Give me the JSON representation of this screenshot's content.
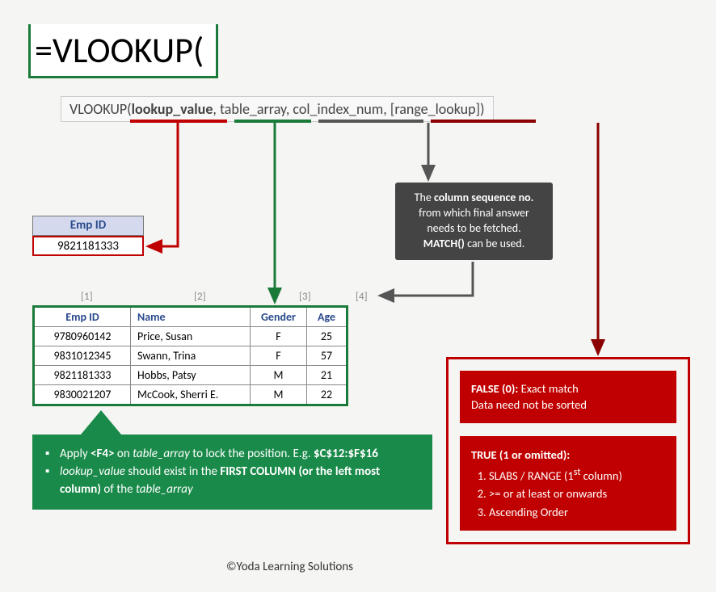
{
  "formula": "=VLOOKUP(",
  "syntax": {
    "fn": "VLOOKUP(",
    "arg1": "lookup_value",
    "sep": ", ",
    "arg2": "table_array",
    "arg3": "col_index_num",
    "arg4": "[range_lookup]",
    "close": ")"
  },
  "lookup_cell": {
    "header": "Emp ID",
    "value": "9821181333"
  },
  "col_nums": [
    "[1]",
    "[2]",
    "[3]",
    "[4]"
  ],
  "table": {
    "headers": [
      "Emp ID",
      "Name",
      "Gender",
      "Age"
    ],
    "rows": [
      [
        "9780960142",
        "Price, Susan",
        "F",
        "25"
      ],
      [
        "9831012345",
        "Swann, Trina",
        "F",
        "57"
      ],
      [
        "9821181333",
        "Hobbs, Patsy",
        "M",
        "21"
      ],
      [
        "9830021207",
        "McCook, Sherri E.",
        "M",
        "22"
      ]
    ]
  },
  "dark_callout": {
    "l1a": "The ",
    "l1b": "column sequence no.",
    "l2": "from which final answer",
    "l3": "needs to be fetched.",
    "l4a": "MATCH()",
    "l4b": " can be used."
  },
  "green_callout": {
    "tip1_a": "Apply ",
    "tip1_b": "<F4>",
    "tip1_c": " on ",
    "tip1_d": "table_array",
    "tip1_e": " to lock the position. E.g. ",
    "tip1_f": "$C$12:$F$16",
    "tip2_a": "lookup_value",
    "tip2_b": " should exist in the ",
    "tip2_c": "FIRST COLUMN (or the left most column)",
    "tip2_d": " of the ",
    "tip2_e": "table_array"
  },
  "red_box": {
    "false_title": "FALSE (0):",
    "false_text": " Exact match",
    "false_l2": "Data need not be sorted",
    "true_title": "TRUE (1 or omitted):",
    "true_item1a": "SLABS / RANGE (1",
    "true_item1b": "st",
    "true_item1c": " column)",
    "true_item2": ">= or at least or onwards",
    "true_item3": "Ascending Order"
  },
  "copyright": "©Yoda Learning Solutions"
}
